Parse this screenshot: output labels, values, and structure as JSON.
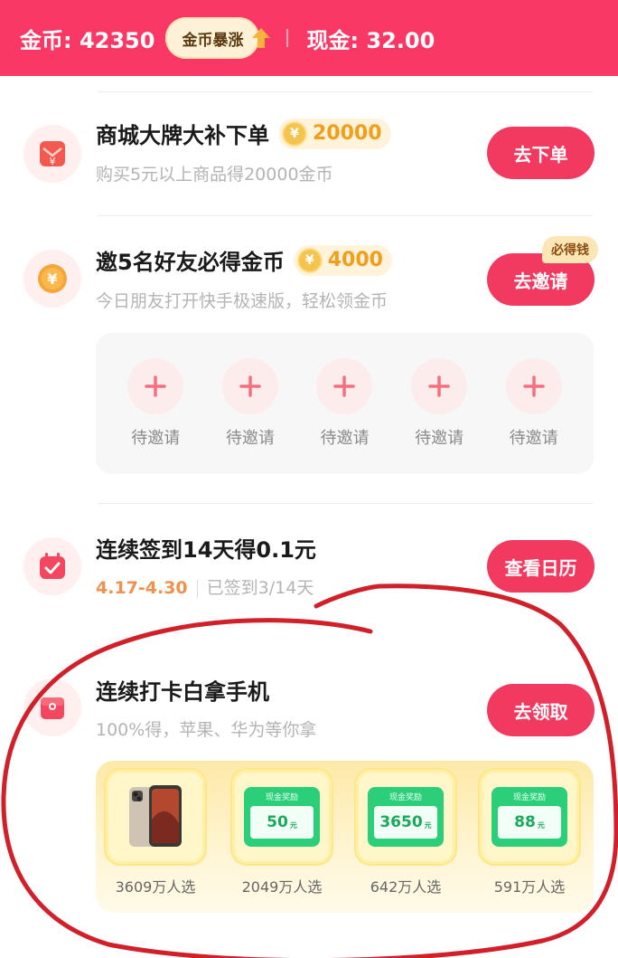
{
  "header": {
    "coins_label": "金币: 42350",
    "boom_button": "金币暴涨",
    "cash_label": "现金: 32.00"
  },
  "tasks": [
    {
      "title": "商城大牌大补下单",
      "reward": "20000",
      "subtitle": "购买5元以上商品得20000金币",
      "button": "去下单",
      "icon": "red-envelope-icon"
    },
    {
      "title": "邀5名好友必得金币",
      "reward": "4000",
      "subtitle": "今日朋友打开快手极速版，轻松领金币",
      "button": "去邀请",
      "badge": "必得钱",
      "icon": "coin-icon",
      "invite_slots": [
        "待邀请",
        "待邀请",
        "待邀请",
        "待邀请",
        "待邀请"
      ]
    },
    {
      "title": "连续签到14天得0.1元",
      "date_range": "4.17-4.30",
      "checked": "已签到3/14天",
      "button": "查看日历",
      "icon": "calendar-icon"
    },
    {
      "title": "连续打卡白拿手机",
      "subtitle": "100%得，苹果、华为等你拿",
      "button": "去领取",
      "icon": "gift-box-icon",
      "prizes": [
        {
          "type": "phone",
          "label": "3609万人选"
        },
        {
          "type": "cash",
          "head": "现金奖励",
          "amount": "50",
          "unit": "元",
          "label": "2049万人选"
        },
        {
          "type": "cash",
          "head": "现金奖励",
          "amount": "3650",
          "unit": "元",
          "label": "642万人选"
        },
        {
          "type": "cash",
          "head": "现金奖励",
          "amount": "88",
          "unit": "元",
          "label": "591万人选"
        }
      ]
    }
  ],
  "colors": {
    "header_bg": "#f93866",
    "button_bg": "#f2395f",
    "reward_text": "#f29e1a",
    "annotation": "#d0202a"
  }
}
